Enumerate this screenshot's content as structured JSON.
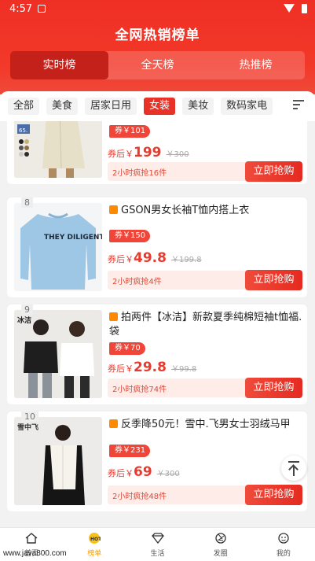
{
  "status_bar": {
    "time": "4:57"
  },
  "header": {
    "title": "全网热销榜单"
  },
  "segments": [
    {
      "label": "实时榜",
      "active": true
    },
    {
      "label": "全天榜",
      "active": false
    },
    {
      "label": "热推榜",
      "active": false
    }
  ],
  "categories": [
    {
      "label": "全部",
      "active": false
    },
    {
      "label": "美食",
      "active": false
    },
    {
      "label": "居家日用",
      "active": false
    },
    {
      "label": "女装",
      "active": true
    },
    {
      "label": "美妆",
      "active": false
    },
    {
      "label": "数码家电",
      "active": false
    }
  ],
  "products": [
    {
      "rank": "",
      "title": "",
      "coupon": "券￥101",
      "price_prefix": "券后",
      "price_symbol": "￥",
      "price": "199",
      "original": "￥300",
      "sold": "2小时疯抢16件",
      "buy": "立即抢购",
      "thumb_label": "65."
    },
    {
      "rank": "8",
      "title": "GSON男女长袖T恤内搭上衣",
      "coupon": "券￥150",
      "price_prefix": "券后",
      "price_symbol": "￥",
      "price": "49.8",
      "original": "￥199.8",
      "sold": "2小时疯抢4件",
      "buy": "立即抢购",
      "thumb_label": "THEY DILIGENT"
    },
    {
      "rank": "9",
      "title": "拍两件【冰洁】新款夏季纯棉短袖t恤福.袋",
      "coupon": "券￥70",
      "price_prefix": "券后",
      "price_symbol": "￥",
      "price": "29.8",
      "original": "￥99.8",
      "sold": "2小时疯抢74件",
      "buy": "立即抢购",
      "thumb_label": "冰洁"
    },
    {
      "rank": "10",
      "title": "反季降50元！雪中.飞男女士羽绒马甲",
      "coupon": "券￥231",
      "price_prefix": "券后",
      "price_symbol": "￥",
      "price": "69",
      "original": "￥300",
      "sold": "2小时疯抢48件",
      "buy": "立即抢购",
      "thumb_label": "雪中飞"
    }
  ],
  "tabs": [
    {
      "label": "首页",
      "icon": "home-icon",
      "active": false
    },
    {
      "label": "榜单",
      "icon": "hot-icon",
      "active": true
    },
    {
      "label": "生活",
      "icon": "diamond-icon",
      "active": false
    },
    {
      "label": "发圈",
      "icon": "aperture-icon",
      "active": false
    },
    {
      "label": "我的",
      "icon": "profile-icon",
      "active": false
    }
  ],
  "watermark": "www.java800.com",
  "colors": {
    "primary": "#e83228",
    "tab_active": "#f5a100"
  }
}
